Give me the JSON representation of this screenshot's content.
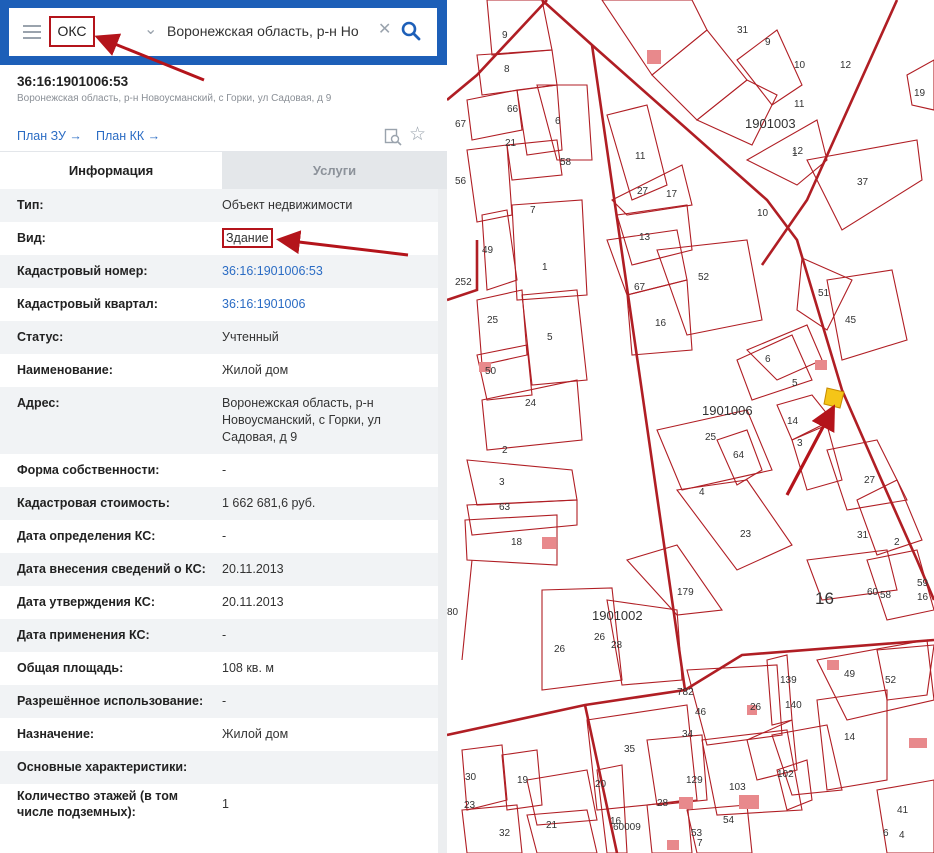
{
  "search": {
    "type_value": "ОКС",
    "query": "Воронежская область, р-н Но"
  },
  "object": {
    "number": "36:16:1901006:53",
    "address": "Воронежская область, р-н Новоусманский, с Горки, ул Садовая, д 9"
  },
  "links": {
    "plan_zu": "План ЗУ →",
    "plan_kk": "План КК →"
  },
  "tabs": {
    "info": "Информация",
    "services": "Услуги"
  },
  "properties": [
    {
      "label": "Тип:",
      "value": "Объект недвижимости"
    },
    {
      "label": "Вид:",
      "value": "Здание"
    },
    {
      "label": "Кадастровый номер:",
      "value": "36:16:1901006:53"
    },
    {
      "label": "Кадастровый квартал:",
      "value": "36:16:1901006"
    },
    {
      "label": "Статус:",
      "value": "Учтенный"
    },
    {
      "label": "Наименование:",
      "value": "Жилой дом"
    },
    {
      "label": "Адрес:",
      "value": "Воронежская область, р-н Новоусманский, с Горки, ул Садовая, д 9"
    },
    {
      "label": "Форма собственности:",
      "value": "-"
    },
    {
      "label": "Кадастровая стоимость:",
      "value": "1 662 681,6 руб."
    },
    {
      "label": "Дата определения КС:",
      "value": "-"
    },
    {
      "label": "Дата внесения сведений о КС:",
      "value": "20.11.2013"
    },
    {
      "label": "Дата утверждения КС:",
      "value": "20.11.2013"
    },
    {
      "label": "Дата применения КС:",
      "value": "-"
    },
    {
      "label": "Общая площадь:",
      "value": "108 кв. м"
    },
    {
      "label": "Разрешённое использование:",
      "value": "-"
    },
    {
      "label": "Назначение:",
      "value": "Жилой дом"
    },
    {
      "label": "Основные характеристики:",
      "value": ""
    },
    {
      "label": "Количество этажей (в том числе подземных):",
      "value": "1"
    }
  ],
  "map": {
    "quarters": [
      "1901003",
      "1901006",
      "1901002",
      "16"
    ],
    "parcel_labels": [
      "9",
      "8",
      "31",
      "9",
      "10",
      "12",
      "11",
      "12",
      "1",
      "37",
      "19",
      "67",
      "66",
      "21",
      "6",
      "58",
      "56",
      "11",
      "27",
      "17",
      "7",
      "13",
      "10",
      "49",
      "1",
      "67",
      "52",
      "51",
      "252",
      "25",
      "45",
      "16",
      "5",
      "6",
      "5",
      "50",
      "24",
      "25",
      "64",
      "14",
      "3",
      "2",
      "27",
      "3",
      "63",
      "4",
      "18",
      "23",
      "31",
      "2",
      "59",
      "16",
      "60",
      "58",
      "179",
      "80",
      "26",
      "26",
      "28",
      "49",
      "52",
      "139",
      "140",
      "782",
      "46",
      "26",
      "35",
      "34",
      "14",
      "30",
      "19",
      "20",
      "129",
      "103",
      "102",
      "23",
      "21",
      "28",
      "16",
      "53",
      "54",
      "41",
      "32",
      "60009",
      "7",
      "6",
      "4"
    ],
    "colors": {
      "boundary": "#b01e24",
      "selected_parcel": "#f5c518",
      "building": "#e8898c"
    }
  }
}
